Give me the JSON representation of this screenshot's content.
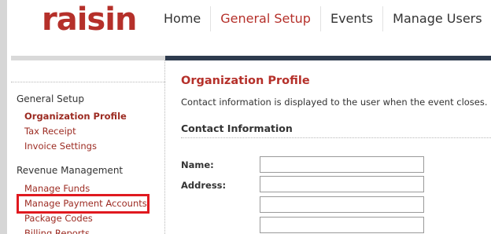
{
  "brand": {
    "logo_text": "raisin",
    "brand_color": "#b5302a"
  },
  "nav": {
    "items": [
      {
        "label": "Home",
        "active": false
      },
      {
        "label": "General Setup",
        "active": true
      },
      {
        "label": "Events",
        "active": false
      },
      {
        "label": "Manage Users",
        "active": false
      }
    ]
  },
  "sidebar": {
    "sections": [
      {
        "heading": "General Setup",
        "links": [
          {
            "label": "Organization Profile",
            "active": true
          },
          {
            "label": "Tax Receipt",
            "active": false
          },
          {
            "label": "Invoice Settings",
            "active": false
          }
        ]
      },
      {
        "heading": "Revenue Management",
        "links": [
          {
            "label": "Manage Funds",
            "active": false
          },
          {
            "label": "Manage Payment Accounts",
            "active": false,
            "highlighted": true
          },
          {
            "label": "Package Codes",
            "active": false
          },
          {
            "label": "Billing Reports",
            "active": false
          }
        ]
      }
    ]
  },
  "main": {
    "title": "Organization Profile",
    "description": "Contact information is displayed to the user when the event closes.",
    "section_title": "Contact Information",
    "fields": {
      "name_label": "Name:",
      "name_value": "",
      "address_label": "Address:",
      "address_line1": "",
      "address_line2": "",
      "address_line3": ""
    }
  },
  "colors": {
    "accent": "#b5302a",
    "highlight_box": "#e0191f",
    "header_bar": "#2e3b4e"
  }
}
